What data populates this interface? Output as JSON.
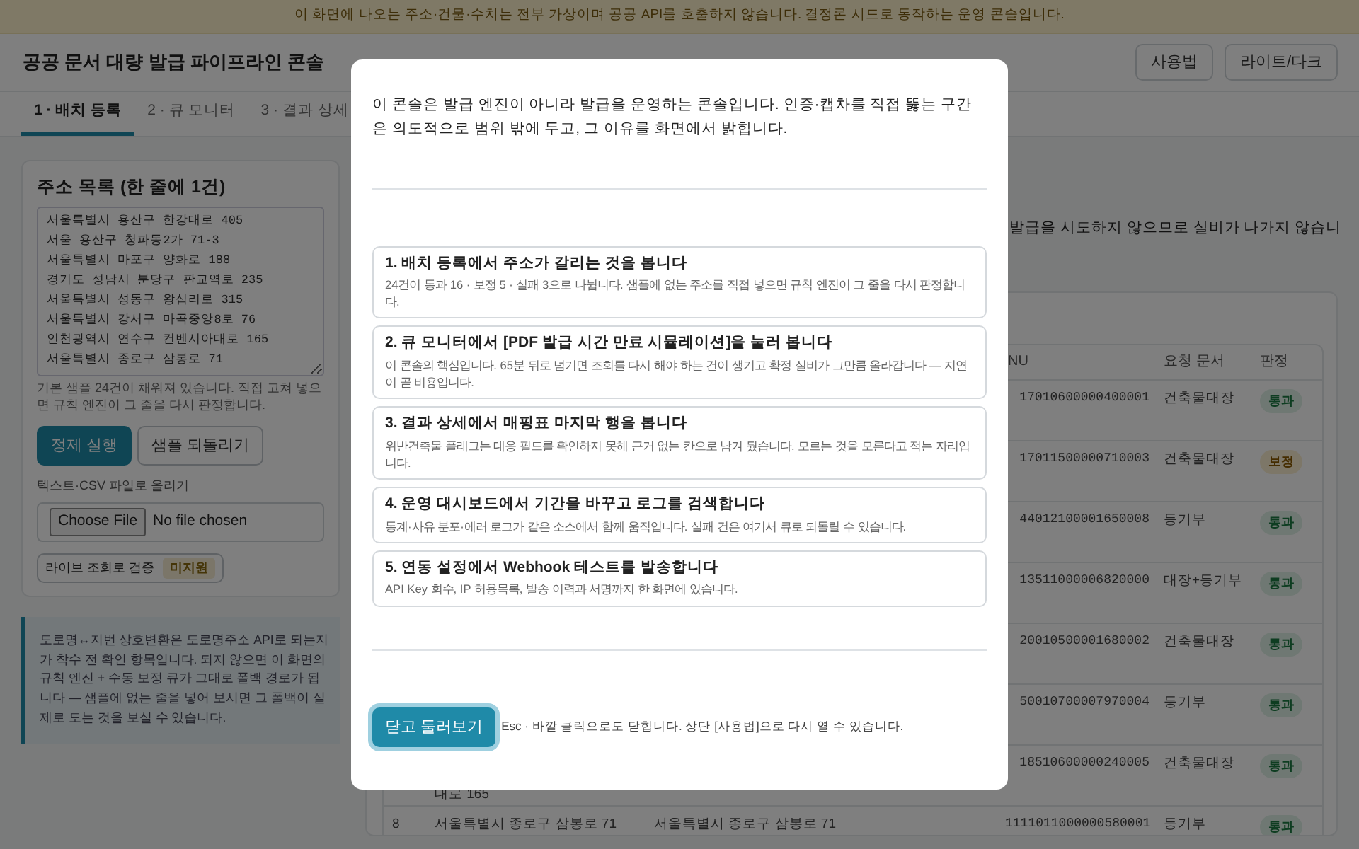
{
  "banner": {
    "text": "이 화면에 나오는 주소·건물·수치는 전부 가상이며 공공 API를 호출하지 않습니다. 결정론 시드로 동작하는 운영 콘솔입니다."
  },
  "header": {
    "title": "공공 문서 대량 발급 파이프라인 콘솔",
    "buttons": [
      "사용법",
      "라이트/다크"
    ]
  },
  "tabs": [
    {
      "label": "1 · 배치 등록",
      "selected": true
    },
    {
      "label": "2 · 큐 모니터",
      "selected": false
    },
    {
      "label": "3 · 결과 상세",
      "selected": false
    }
  ],
  "address_card": {
    "title": "주소 목록 (한 줄에 1건)",
    "textarea": {
      "value": "서울특별시 용산구 한강대로 405\n서울 용산구 청파동2가 71-3\n서울특별시 마포구 양화로 188\n경기도 성남시 분당구 판교역로 235\n서울특별시 성동구 왕십리로 315\n서울특별시 강서구 마곡중앙8로 76\n인천광역시 연수구 컨벤시아대로 165\n서울특별시 종로구 삼봉로 71"
    },
    "help": "기본 샘플 24건이 채워져 있습니다. 직접 고쳐 넣으면 규칙 엔진이 그 줄을 다시 판정합니다.",
    "buttons": [
      {
        "label": "정제 실행",
        "kind": "primary"
      },
      {
        "label": "샘플 되돌리기",
        "kind": "secondary"
      }
    ],
    "upload": {
      "label": "텍스트·CSV 파일로 올리기",
      "button": "Choose File",
      "status": "No file chosen"
    },
    "live_toggle": {
      "label": "라이브 조회로 검증",
      "badge": "미지원"
    }
  },
  "callout": {
    "text": "도로명↔지번 상호변환은 도로명주소 API로 되는지가 착수 전 확인 항목입니다. 되지 않으면 이 화면의 규칙 엔진 + 수동 보정 큐가 그대로 폴백 경로가 됩니다 — 샘플에 없는 줄을 넣어 보시면 그 폴백이 실제로 도는 것을 보실 수 있습니다."
  },
  "results": {
    "note": "발급을 시도하지 않으므로 실비가 나가지 않습니",
    "table": {
      "columns": [
        "NU",
        "요청 문서",
        "판정"
      ],
      "rows": [
        {
          "pnu": "17010600000400001",
          "document": "건축물대장",
          "verdict": {
            "label": "통과",
            "kind": "pass"
          }
        },
        {
          "pnu": "17011500000710003",
          "document": "건축물대장",
          "verdict": {
            "label": "보정",
            "kind": "corrected"
          }
        },
        {
          "pnu": "44012100001650008",
          "document": "등기부",
          "verdict": {
            "label": "통과",
            "kind": "pass"
          }
        },
        {
          "pnu": "13511000006820000",
          "document": "대장+등기부",
          "verdict": {
            "label": "통과",
            "kind": "pass"
          }
        },
        {
          "pnu": "20010500001680002",
          "document": "건축물대장",
          "verdict": {
            "label": "통과",
            "kind": "pass"
          }
        },
        {
          "pnu": "50010700007970004",
          "document": "등기부",
          "verdict": {
            "label": "통과",
            "kind": "pass"
          }
        },
        {
          "input_address": "대로 165",
          "pnu": "18510600000240005",
          "document": "건축물대장",
          "verdict": {
            "label": "통과",
            "kind": "pass"
          }
        },
        {
          "number": "8",
          "input_address": "서울특별시 종로구 삼봉로 71",
          "refined_address": "서울특별시 종로구 삼봉로 71",
          "pnu": "1111011000000580001",
          "document": "등기부",
          "verdict": {
            "label": "통과",
            "kind": "pass"
          }
        }
      ]
    }
  },
  "modal": {
    "intro": "이 콘솔은 발급 엔진이 아니라 발급을 운영하는 콘솔입니다. 인증·캡차를 직접 뚫는 구간은 의도적으로 범위 밖에 두고, 그 이유를 화면에서 밝힙니다.",
    "steps": [
      {
        "title": "1. 배치 등록에서 주소가 갈리는 것을 봅니다",
        "text": "24건이 통과 16 · 보정 5 · 실패 3으로 나뉩니다. 샘플에 없는 주소를 직접 넣으면 규칙 엔진이 그 줄을 다시 판정합니다."
      },
      {
        "title": "2. 큐 모니터에서 [PDF 발급 시간 만료 시뮬레이션]을 눌러 봅니다",
        "text": "이 콘솔의 핵심입니다. 65분 뒤로 넘기면 조회를 다시 해야 하는 건이 생기고 확정 실비가 그만큼 올라갑니다 — 지연이 곧 비용입니다."
      },
      {
        "title": "3. 결과 상세에서 매핑표 마지막 행을 봅니다",
        "text": "위반건축물 플래그는 대응 필드를 확인하지 못해 근거 없는 칸으로 남겨 뒀습니다. 모르는 것을 모른다고 적는 자리입니다."
      },
      {
        "title": "4. 운영 대시보드에서 기간을 바꾸고 로그를 검색합니다",
        "text": "통계·사유 분포·에러 로그가 같은 소스에서 함께 움직입니다. 실패 건은 여기서 큐로 되돌릴 수 있습니다."
      },
      {
        "title": "5. 연동 설정에서 Webhook 테스트를 발송합니다",
        "text": "API Key 회수, IP 허용목록, 발송 이력과 서명까지 한 화면에 있습니다."
      }
    ],
    "close_button": "닫고 둘러보기",
    "footer_note": "Esc · 바깥 클릭으로도 닫힙니다. 상단 [사용법]으로 다시 열 수 있습니다."
  }
}
